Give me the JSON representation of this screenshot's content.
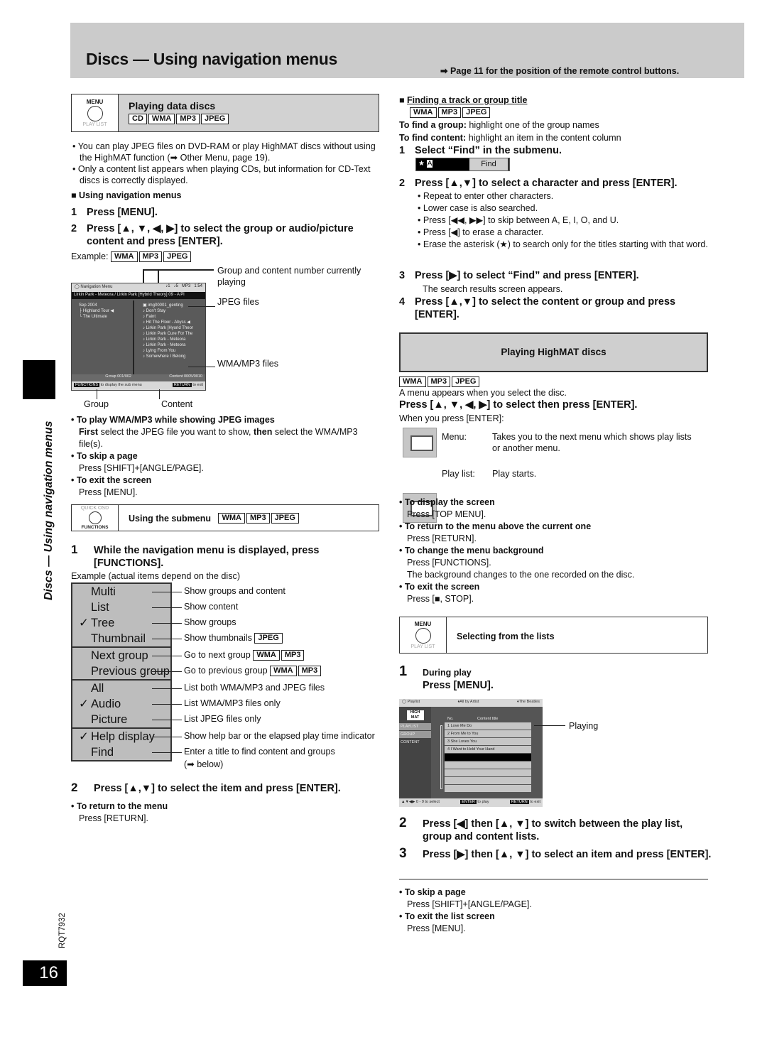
{
  "header": {
    "title": "Discs — Using navigation menus",
    "reference": "➡ Page 11 for the position of the remote control buttons."
  },
  "side_label": "Discs — Using navigation menus",
  "doc_code": "RQT7932",
  "page_number": "16",
  "left": {
    "section1": {
      "button_top": "MENU",
      "button_bottom": "PLAY LIST",
      "title": "Playing data discs",
      "tags": [
        "CD",
        "WMA",
        "MP3",
        "JPEG"
      ]
    },
    "bullets": [
      "You can play JPEG files on DVD-RAM or play HighMAT discs without using the HighMAT function (➡ Other Menu, page 19).",
      "Only a content list appears when playing CDs, but information for CD-Text discs is correctly displayed."
    ],
    "subheading": "Using navigation menus",
    "steps": [
      {
        "n": "1",
        "text": "Press [MENU]."
      },
      {
        "n": "2",
        "text": "Press [▲, ▼, ◀, ▶] to select the group or audio/picture content and press [ENTER]."
      }
    ],
    "example_label": "Example:",
    "example_tags": [
      "WMA",
      "MP3",
      "JPEG"
    ],
    "nav_screen": {
      "title": "Navigation Menu",
      "group_num": "1",
      "content_num": "5",
      "format": "MP3",
      "time": "1:54",
      "now_playing": "Lirkin Park -  Meteora / Lirkin  Park [Hybrid Theory]  09 -   A Pl",
      "groups": [
        "Sep 2004",
        "Highland Tour",
        "The Ultimate"
      ],
      "contents": [
        "img00001_genting",
        "Don't Stay",
        "Faint",
        "Hit The Floor - Abyss",
        "Lirkin Park [Hyorid Theor",
        "Lirkin Park Cure For The",
        "Lirkin Park -   Meteora",
        "Lirkin Park -   Meteora",
        "Lying From You",
        "Somewhere I Belong"
      ],
      "group_counter": "Group 001/002",
      "content_counter": "Content 0005/0010",
      "help_left_key": "FUNCTIONS",
      "help_left": "to display the sub menu",
      "help_right_key": "RETURN",
      "help_right": "to exit"
    },
    "callouts": {
      "number": "Group and content number currently playing",
      "jpeg": "JPEG files",
      "wma": "WMA/MP3 files",
      "group": "Group",
      "content": "Content"
    },
    "tips": [
      {
        "title": "To play WMA/MP3 while showing JPEG images",
        "body_parts": [
          "First",
          " select the JPEG file you want to show, ",
          "then",
          " select the WMA/MP3 file(s)."
        ]
      },
      {
        "title": "To skip a page",
        "body": "Press [SHIFT]+[ANGLE/PAGE]."
      },
      {
        "title": "To exit the screen",
        "body": "Press [MENU]."
      }
    ],
    "section2": {
      "button_top": "QUICK OSD",
      "button_bottom": "FUNCTIONS",
      "title": "Using the submenu",
      "tags": [
        "WMA",
        "MP3",
        "JPEG"
      ]
    },
    "sub_step1": {
      "n": "1",
      "text": "While the navigation menu is displayed, press [FUNCTIONS]."
    },
    "example_note": "Example (actual items depend on the disc)",
    "submenu_groups": [
      [
        {
          "label": "Multi",
          "checked": false,
          "desc": "Show groups and content",
          "tags": []
        },
        {
          "label": "List",
          "checked": false,
          "desc": "Show content",
          "tags": []
        },
        {
          "label": "Tree",
          "checked": true,
          "desc": "Show groups",
          "tags": []
        },
        {
          "label": "Thumbnail",
          "checked": false,
          "desc": "Show thumbnails",
          "tags": [
            "JPEG"
          ]
        }
      ],
      [
        {
          "label": "Next group",
          "checked": false,
          "desc": "Go to next group",
          "tags": [
            "WMA",
            "MP3"
          ]
        },
        {
          "label": "Previous group",
          "checked": false,
          "desc": "Go to previous group",
          "tags": [
            "WMA",
            "MP3"
          ]
        }
      ],
      [
        {
          "label": "All",
          "checked": false,
          "desc": "List both WMA/MP3 and JPEG files",
          "tags": []
        },
        {
          "label": "Audio",
          "checked": true,
          "desc": "List WMA/MP3 files only",
          "tags": []
        },
        {
          "label": "Picture",
          "checked": false,
          "desc": "List JPEG files only",
          "tags": []
        }
      ],
      [
        {
          "label": "Help display",
          "checked": true,
          "desc": "Show help bar or the elapsed play time indicator",
          "tags": []
        },
        {
          "label": "Find",
          "checked": false,
          "desc": "Enter a title to find content and groups",
          "tags": []
        }
      ]
    ],
    "find_note": "(➡ below)",
    "sub_step2": {
      "n": "2",
      "text": "Press [▲,▼] to select the item and press [ENTER]."
    },
    "return_tip": {
      "title": "To return to the menu",
      "body": "Press [RETURN]."
    }
  },
  "right": {
    "find": {
      "heading": "Finding a track or group title",
      "tags": [
        "WMA",
        "MP3",
        "JPEG"
      ],
      "group_label": "To find a group:",
      "group_text": " highlight one of the group names",
      "content_label": "To find content:",
      "content_text": " highlight an item in the content column",
      "step1": {
        "n": "1",
        "text": "Select “Find” in the submenu."
      },
      "find_field": {
        "value": "A",
        "prefix": "★",
        "button": "Find"
      },
      "step2": {
        "n": "2",
        "text": "Press [▲,▼] to select a character and press [ENTER]."
      },
      "step2_bullets": [
        "Repeat to enter other characters.",
        "Lower case is also searched.",
        "Press [◀◀, ▶▶] to skip between A, E, I, O, and U.",
        "Press [◀] to erase a character.",
        "Erase the asterisk (★) to search only for the titles starting with that word."
      ],
      "step3": {
        "n": "3",
        "text": "Press [▶] to select “Find” and press [ENTER]."
      },
      "step3_note": "The search results screen appears.",
      "step4": {
        "n": "4",
        "text": "Press [▲,▼] to select the content or group and press [ENTER]."
      }
    },
    "highmat": {
      "title": "Playing HighMAT discs",
      "tags": [
        "WMA",
        "MP3",
        "JPEG"
      ],
      "intro": "A menu appears when you select the disc.",
      "instruction": "Press [▲, ▼, ◀, ▶] to select then press [ENTER].",
      "when_enter": "When you press [ENTER]:",
      "icons": [
        {
          "label": "Menu:",
          "desc": "Takes you to the next menu which shows play lists or another menu."
        },
        {
          "label": "Play list:",
          "desc": "Play starts."
        }
      ],
      "tips": [
        {
          "title": "To display the screen",
          "body": [
            "Press [TOP MENU]."
          ]
        },
        {
          "title": "To return to the menu above the current one",
          "body": [
            "Press [RETURN]."
          ]
        },
        {
          "title": "To change the menu background",
          "body": [
            "Press [FUNCTIONS].",
            "The background changes to the one recorded on the disc."
          ]
        },
        {
          "title": "To exit the screen",
          "body": [
            "Press [■, STOP]."
          ]
        }
      ]
    },
    "lists": {
      "button_top": "MENU",
      "button_bottom": "PLAY LIST",
      "title": "Selecting from the lists",
      "step1_n": "1",
      "step1_small": "During play",
      "step1_main": "Press [MENU].",
      "screen": {
        "title": "Playlist",
        "crumb1": "♦All by Artist",
        "crumb2": "♦The Beatles",
        "logo": "HIGH MAT",
        "side_items": [
          "PLAYLIST",
          "GROUP",
          "CONTENT"
        ],
        "col_no": "No.",
        "col_title": "Content title",
        "rows": [
          {
            "no": "1",
            "title": "Love Me Do"
          },
          {
            "no": "2",
            "title": "From Me to You"
          },
          {
            "no": "3",
            "title": "She Loves You"
          },
          {
            "no": "4",
            "title": "I Want to Hold Your Hand"
          }
        ],
        "help_select": "▲▼◀▶ 0 - 9 to select",
        "help_enter_key": "ENTER",
        "help_enter": "to play",
        "help_return_key": "RETURN",
        "help_return": "to exit"
      },
      "playing_label": "Playing",
      "step2": {
        "n": "2",
        "text": "Press [◀] then [▲, ▼] to switch between the play list, group and content lists."
      },
      "step3": {
        "n": "3",
        "text": "Press [▶] then [▲, ▼] to select an item and press [ENTER]."
      },
      "tips": [
        {
          "title": "To skip a page",
          "body": "Press [SHIFT]+[ANGLE/PAGE]."
        },
        {
          "title": "To exit the list screen",
          "body": "Press [MENU]."
        }
      ]
    }
  }
}
